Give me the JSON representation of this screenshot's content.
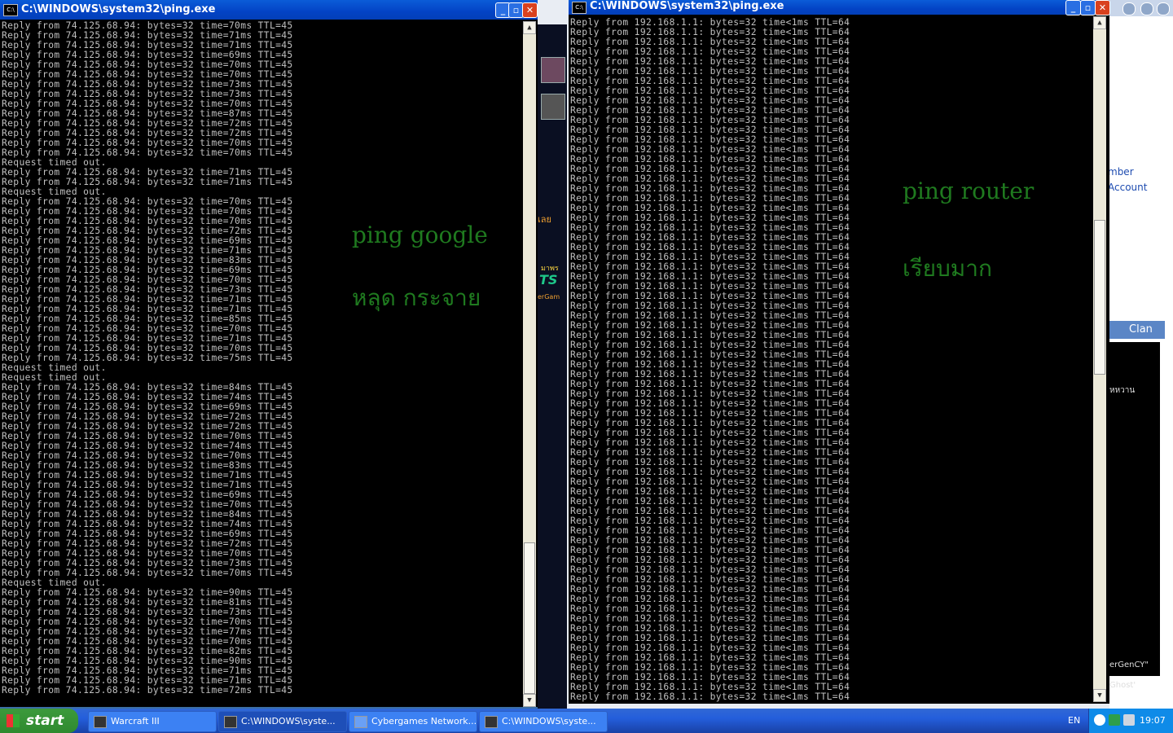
{
  "windows": [
    {
      "title": "C:\\WINDOWS\\system32\\ping.exe",
      "note_lines": [
        "ping google",
        "หลุด กระจาย"
      ],
      "lines": [
        "Reply from 74.125.68.94: bytes=32 time=70ms TTL=45",
        "Reply from 74.125.68.94: bytes=32 time=71ms TTL=45",
        "Reply from 74.125.68.94: bytes=32 time=71ms TTL=45",
        "Reply from 74.125.68.94: bytes=32 time=69ms TTL=45",
        "Reply from 74.125.68.94: bytes=32 time=70ms TTL=45",
        "Reply from 74.125.68.94: bytes=32 time=70ms TTL=45",
        "Reply from 74.125.68.94: bytes=32 time=73ms TTL=45",
        "Reply from 74.125.68.94: bytes=32 time=73ms TTL=45",
        "Reply from 74.125.68.94: bytes=32 time=70ms TTL=45",
        "Reply from 74.125.68.94: bytes=32 time=87ms TTL=45",
        "Reply from 74.125.68.94: bytes=32 time=72ms TTL=45",
        "Reply from 74.125.68.94: bytes=32 time=72ms TTL=45",
        "Reply from 74.125.68.94: bytes=32 time=70ms TTL=45",
        "Reply from 74.125.68.94: bytes=32 time=70ms TTL=45",
        "Request timed out.",
        "Reply from 74.125.68.94: bytes=32 time=71ms TTL=45",
        "Reply from 74.125.68.94: bytes=32 time=71ms TTL=45",
        "Request timed out.",
        "Reply from 74.125.68.94: bytes=32 time=70ms TTL=45",
        "Reply from 74.125.68.94: bytes=32 time=70ms TTL=45",
        "Reply from 74.125.68.94: bytes=32 time=70ms TTL=45",
        "Reply from 74.125.68.94: bytes=32 time=72ms TTL=45",
        "Reply from 74.125.68.94: bytes=32 time=69ms TTL=45",
        "Reply from 74.125.68.94: bytes=32 time=71ms TTL=45",
        "Reply from 74.125.68.94: bytes=32 time=83ms TTL=45",
        "Reply from 74.125.68.94: bytes=32 time=69ms TTL=45",
        "Reply from 74.125.68.94: bytes=32 time=70ms TTL=45",
        "Reply from 74.125.68.94: bytes=32 time=73ms TTL=45",
        "Reply from 74.125.68.94: bytes=32 time=71ms TTL=45",
        "Reply from 74.125.68.94: bytes=32 time=71ms TTL=45",
        "Reply from 74.125.68.94: bytes=32 time=85ms TTL=45",
        "Reply from 74.125.68.94: bytes=32 time=70ms TTL=45",
        "Reply from 74.125.68.94: bytes=32 time=71ms TTL=45",
        "Reply from 74.125.68.94: bytes=32 time=70ms TTL=45",
        "Reply from 74.125.68.94: bytes=32 time=75ms TTL=45",
        "Request timed out.",
        "Request timed out.",
        "Reply from 74.125.68.94: bytes=32 time=84ms TTL=45",
        "Reply from 74.125.68.94: bytes=32 time=74ms TTL=45",
        "Reply from 74.125.68.94: bytes=32 time=69ms TTL=45",
        "Reply from 74.125.68.94: bytes=32 time=72ms TTL=45",
        "Reply from 74.125.68.94: bytes=32 time=72ms TTL=45",
        "Reply from 74.125.68.94: bytes=32 time=70ms TTL=45",
        "Reply from 74.125.68.94: bytes=32 time=74ms TTL=45",
        "Reply from 74.125.68.94: bytes=32 time=70ms TTL=45",
        "Reply from 74.125.68.94: bytes=32 time=83ms TTL=45",
        "Reply from 74.125.68.94: bytes=32 time=71ms TTL=45",
        "Reply from 74.125.68.94: bytes=32 time=71ms TTL=45",
        "Reply from 74.125.68.94: bytes=32 time=69ms TTL=45",
        "Reply from 74.125.68.94: bytes=32 time=70ms TTL=45",
        "Reply from 74.125.68.94: bytes=32 time=84ms TTL=45",
        "Reply from 74.125.68.94: bytes=32 time=74ms TTL=45",
        "Reply from 74.125.68.94: bytes=32 time=69ms TTL=45",
        "Reply from 74.125.68.94: bytes=32 time=72ms TTL=45",
        "Reply from 74.125.68.94: bytes=32 time=70ms TTL=45",
        "Reply from 74.125.68.94: bytes=32 time=73ms TTL=45",
        "Reply from 74.125.68.94: bytes=32 time=70ms TTL=45",
        "Request timed out.",
        "Reply from 74.125.68.94: bytes=32 time=90ms TTL=45",
        "Reply from 74.125.68.94: bytes=32 time=81ms TTL=45",
        "Reply from 74.125.68.94: bytes=32 time=73ms TTL=45",
        "Reply from 74.125.68.94: bytes=32 time=70ms TTL=45",
        "Reply from 74.125.68.94: bytes=32 time=77ms TTL=45",
        "Reply from 74.125.68.94: bytes=32 time=70ms TTL=45",
        "Reply from 74.125.68.94: bytes=32 time=82ms TTL=45",
        "Reply from 74.125.68.94: bytes=32 time=90ms TTL=45",
        "Reply from 74.125.68.94: bytes=32 time=71ms TTL=45",
        "Reply from 74.125.68.94: bytes=32 time=71ms TTL=45",
        "Reply from 74.125.68.94: bytes=32 time=72ms TTL=45"
      ]
    },
    {
      "title": "C:\\WINDOWS\\system32\\ping.exe",
      "note_lines": [
        "ping router",
        "เรียบมาก"
      ],
      "lines": [
        "Reply from 192.168.1.1: bytes=32 time<1ms TTL=64",
        "Reply from 192.168.1.1: bytes=32 time<1ms TTL=64",
        "Reply from 192.168.1.1: bytes=32 time<1ms TTL=64",
        "Reply from 192.168.1.1: bytes=32 time<1ms TTL=64",
        "Reply from 192.168.1.1: bytes=32 time<1ms TTL=64",
        "Reply from 192.168.1.1: bytes=32 time<1ms TTL=64",
        "Reply from 192.168.1.1: bytes=32 time<1ms TTL=64",
        "Reply from 192.168.1.1: bytes=32 time<1ms TTL=64",
        "Reply from 192.168.1.1: bytes=32 time<1ms TTL=64",
        "Reply from 192.168.1.1: bytes=32 time<1ms TTL=64",
        "Reply from 192.168.1.1: bytes=32 time<1ms TTL=64",
        "Reply from 192.168.1.1: bytes=32 time<1ms TTL=64",
        "Reply from 192.168.1.1: bytes=32 time<1ms TTL=64",
        "Reply from 192.168.1.1: bytes=32 time<1ms TTL=64",
        "Reply from 192.168.1.1: bytes=32 time<1ms TTL=64",
        "Reply from 192.168.1.1: bytes=32 time<1ms TTL=64",
        "Reply from 192.168.1.1: bytes=32 time<1ms TTL=64",
        "Reply from 192.168.1.1: bytes=32 time<1ms TTL=64",
        "Reply from 192.168.1.1: bytes=32 time<1ms TTL=64",
        "Reply from 192.168.1.1: bytes=32 time<1ms TTL=64",
        "Reply from 192.168.1.1: bytes=32 time<1ms TTL=64",
        "Reply from 192.168.1.1: bytes=32 time<1ms TTL=64",
        "Reply from 192.168.1.1: bytes=32 time<1ms TTL=64",
        "Reply from 192.168.1.1: bytes=32 time<1ms TTL=64",
        "Reply from 192.168.1.1: bytes=32 time<1ms TTL=64",
        "Reply from 192.168.1.1: bytes=32 time<1ms TTL=64",
        "Reply from 192.168.1.1: bytes=32 time<1ms TTL=64",
        "Reply from 192.168.1.1: bytes=32 time=1ms TTL=64",
        "Reply from 192.168.1.1: bytes=32 time<1ms TTL=64",
        "Reply from 192.168.1.1: bytes=32 time<1ms TTL=64",
        "Reply from 192.168.1.1: bytes=32 time<1ms TTL=64",
        "Reply from 192.168.1.1: bytes=32 time<1ms TTL=64",
        "Reply from 192.168.1.1: bytes=32 time<1ms TTL=64",
        "Reply from 192.168.1.1: bytes=32 time=1ms TTL=64",
        "Reply from 192.168.1.1: bytes=32 time<1ms TTL=64",
        "Reply from 192.168.1.1: bytes=32 time<1ms TTL=64",
        "Reply from 192.168.1.1: bytes=32 time<1ms TTL=64",
        "Reply from 192.168.1.1: bytes=32 time<1ms TTL=64",
        "Reply from 192.168.1.1: bytes=32 time<1ms TTL=64",
        "Reply from 192.168.1.1: bytes=32 time<1ms TTL=64",
        "Reply from 192.168.1.1: bytes=32 time<1ms TTL=64",
        "Reply from 192.168.1.1: bytes=32 time<1ms TTL=64",
        "Reply from 192.168.1.1: bytes=32 time<1ms TTL=64",
        "Reply from 192.168.1.1: bytes=32 time<1ms TTL=64",
        "Reply from 192.168.1.1: bytes=32 time<1ms TTL=64",
        "Reply from 192.168.1.1: bytes=32 time<1ms TTL=64",
        "Reply from 192.168.1.1: bytes=32 time<1ms TTL=64",
        "Reply from 192.168.1.1: bytes=32 time<1ms TTL=64",
        "Reply from 192.168.1.1: bytes=32 time<1ms TTL=64",
        "Reply from 192.168.1.1: bytes=32 time<1ms TTL=64",
        "Reply from 192.168.1.1: bytes=32 time<1ms TTL=64",
        "Reply from 192.168.1.1: bytes=32 time<1ms TTL=64",
        "Reply from 192.168.1.1: bytes=32 time<1ms TTL=64",
        "Reply from 192.168.1.1: bytes=32 time<1ms TTL=64",
        "Reply from 192.168.1.1: bytes=32 time<1ms TTL=64",
        "Reply from 192.168.1.1: bytes=32 time<1ms TTL=64",
        "Reply from 192.168.1.1: bytes=32 time<1ms TTL=64",
        "Reply from 192.168.1.1: bytes=32 time<1ms TTL=64",
        "Reply from 192.168.1.1: bytes=32 time<1ms TTL=64",
        "Reply from 192.168.1.1: bytes=32 time<1ms TTL=64",
        "Reply from 192.168.1.1: bytes=32 time<1ms TTL=64",
        "Reply from 192.168.1.1: bytes=32 time=1ms TTL=64",
        "Reply from 192.168.1.1: bytes=32 time<1ms TTL=64",
        "Reply from 192.168.1.1: bytes=32 time<1ms TTL=64",
        "Reply from 192.168.1.1: bytes=32 time<1ms TTL=64",
        "Reply from 192.168.1.1: bytes=32 time<1ms TTL=64",
        "Reply from 192.168.1.1: bytes=32 time<1ms TTL=64",
        "Reply from 192.168.1.1: bytes=32 time<1ms TTL=64",
        "Reply from 192.168.1.1: bytes=32 time<1ms TTL=64",
        "Reply from 192.168.1.1: bytes=32 time<1ms TTL=64"
      ]
    }
  ],
  "background_app": {
    "link1": "mber",
    "link2": "Account",
    "clan_tab": "Clan",
    "text_hwan": "หหวาน",
    "text_gency": "erGenCY\"",
    "text_ghost": "Ghost'",
    "banner_text1": "เลย",
    "banner_text2": "มาพร",
    "banner_text3": "TS",
    "banner_text4": "erGam"
  },
  "taskbar": {
    "start_label": "start",
    "tasks": [
      {
        "label": "Warcraft III",
        "icon": "warcraft-icon",
        "active": false
      },
      {
        "label": "C:\\WINDOWS\\syste...",
        "icon": "console-icon",
        "active": true
      },
      {
        "label": "Cybergames Network...",
        "icon": "cybergames-icon",
        "active": false
      },
      {
        "label": "C:\\WINDOWS\\syste...",
        "icon": "console-icon",
        "active": false
      }
    ],
    "language": "EN",
    "clock": "19:07"
  },
  "colors": {
    "console_text": "#c0c0c0",
    "note_green": "#1f7a1f",
    "titlebar_blue": "#0343c5",
    "taskbar_blue": "#245edb",
    "start_green": "#3c9a3c"
  }
}
